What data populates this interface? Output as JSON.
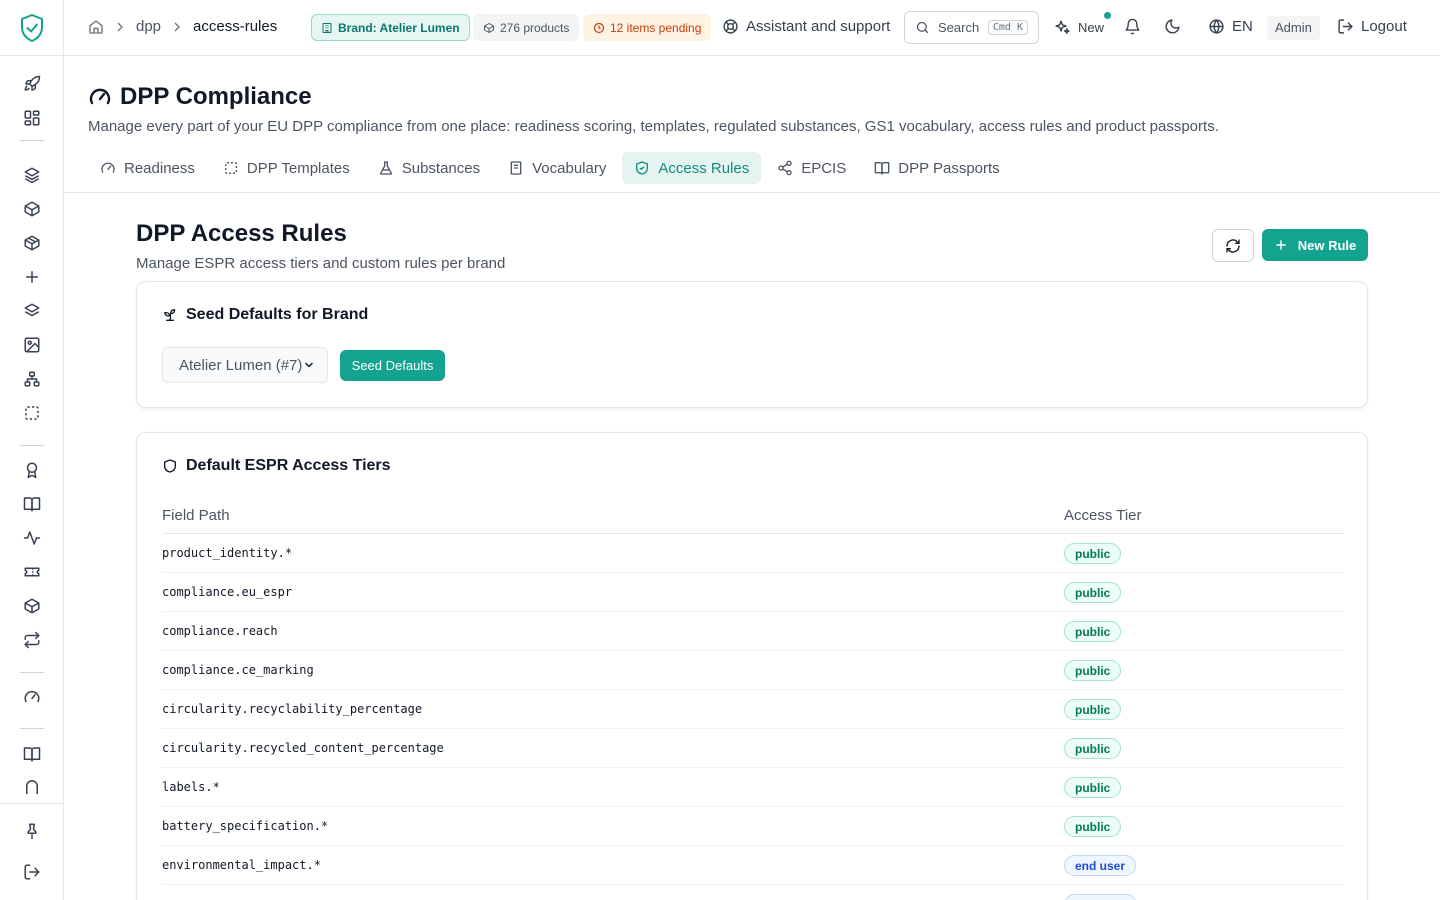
{
  "topbar": {
    "breadcrumb": [
      "dpp",
      "access-rules"
    ],
    "brand_pill": "Brand: Atelier Lumen",
    "products_pill": "276 products",
    "pending_pill": "12 items pending",
    "assistant": "Assistant and support",
    "search_label": "Search",
    "search_shortcut": "Cmd K",
    "new_label": "New",
    "language": "EN",
    "role": "Admin",
    "logout": "Logout"
  },
  "page": {
    "title": "DPP Compliance",
    "description": "Manage every part of your EU DPP compliance from one place: readiness scoring, templates, regulated substances, GS1 vocabulary, access rules and product passports.",
    "tabs": [
      {
        "label": "Readiness",
        "icon": "gauge-icon",
        "active": false
      },
      {
        "label": "DPP Templates",
        "icon": "dashed-square-icon",
        "active": false
      },
      {
        "label": "Substances",
        "icon": "flask-icon",
        "active": false
      },
      {
        "label": "Vocabulary",
        "icon": "book-icon",
        "active": false
      },
      {
        "label": "Access Rules",
        "icon": "shield-check-icon",
        "active": true
      },
      {
        "label": "EPCIS",
        "icon": "share-icon",
        "active": false
      },
      {
        "label": "DPP Passports",
        "icon": "open-book-icon",
        "active": false
      }
    ]
  },
  "section": {
    "title": "DPP Access Rules",
    "description": "Manage ESPR access tiers and custom rules per brand",
    "new_rule": "New Rule"
  },
  "seed": {
    "title": "Seed Defaults for Brand",
    "selected_brand": "Atelier Lumen (#7)",
    "button": "Seed Defaults"
  },
  "tiers": {
    "title": "Default ESPR Access Tiers",
    "col_path": "Field Path",
    "col_tier": "Access Tier",
    "rows": [
      {
        "path": "product_identity.*",
        "tier": "public",
        "kind": "public"
      },
      {
        "path": "compliance.eu_espr",
        "tier": "public",
        "kind": "public"
      },
      {
        "path": "compliance.reach",
        "tier": "public",
        "kind": "public"
      },
      {
        "path": "compliance.ce_marking",
        "tier": "public",
        "kind": "public"
      },
      {
        "path": "circularity.recyclability_percentage",
        "tier": "public",
        "kind": "public"
      },
      {
        "path": "circularity.recycled_content_percentage",
        "tier": "public",
        "kind": "public"
      },
      {
        "path": "labels.*",
        "tier": "public",
        "kind": "public"
      },
      {
        "path": "battery_specification.*",
        "tier": "public",
        "kind": "public"
      },
      {
        "path": "environmental_impact.*",
        "tier": "end user",
        "kind": "end_user"
      },
      {
        "path": "",
        "tier": "",
        "kind": "end_user"
      }
    ]
  },
  "colors": {
    "accent": "#14a38f",
    "public_badge": "#047857",
    "end_user_badge": "#1d4ed8",
    "pending": "#c2410c"
  }
}
